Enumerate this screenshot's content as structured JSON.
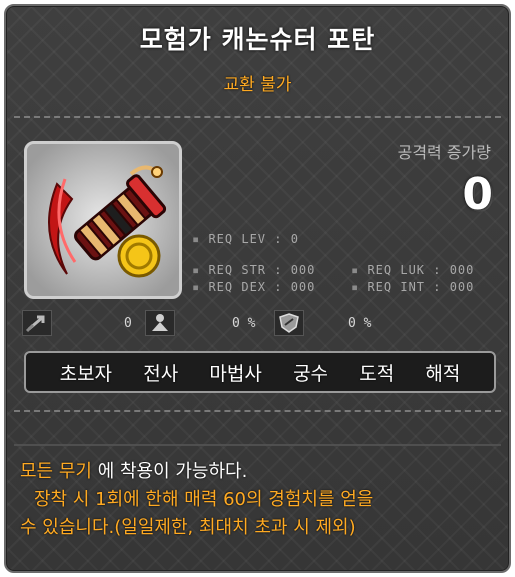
{
  "item": {
    "name": "모험가 캐논슈터 포탄",
    "trade": "교환 불가",
    "attack_label": "공격력 증가량",
    "attack_value": "0"
  },
  "requirements": {
    "lev": "REQ LEV :   0",
    "str": "REQ STR : 000",
    "dex": "REQ DEX : 000",
    "luk": "REQ LUK : 000",
    "int": "REQ INT : 000"
  },
  "stats": {
    "stat1": "0",
    "stat2": "0 %",
    "stat3": "0 %"
  },
  "jobs": [
    "초보자",
    "전사",
    "마법사",
    "궁수",
    "도적",
    "해적"
  ],
  "description": {
    "line1_highlight": "모든 무기",
    "line1_rest": " 에 착용이 가능하다.",
    "line2": "장착 시 1회에 한해 매력 60의 경험치를 얻을",
    "line3": "수 있습니다.(일일제한, 최대치 초과 시 제외)"
  },
  "colors": {
    "accent": "#ffaa22",
    "background": "#3a3a3a",
    "text": "#ffffff"
  },
  "icons": [
    "cannon-shell-icon",
    "arrow-icon",
    "character-icon",
    "shield-icon"
  ]
}
